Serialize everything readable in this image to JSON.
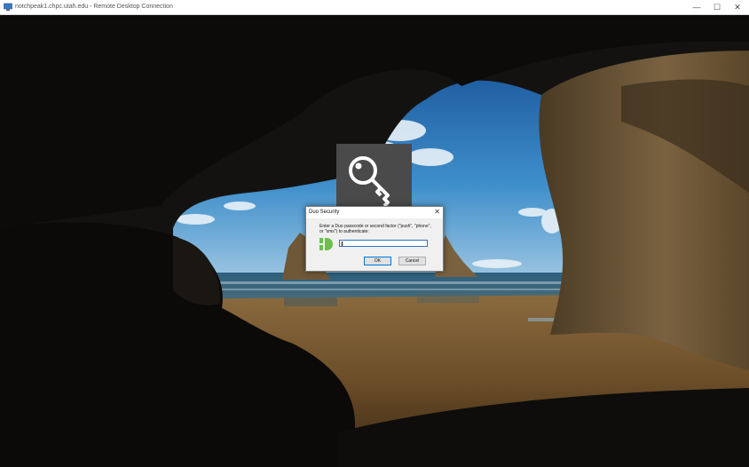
{
  "window": {
    "title": "notchpeak1.chpc.utah.edu - Remote Desktop Connection",
    "minimize": "—",
    "maximize": "☐",
    "close": "✕"
  },
  "dialog": {
    "title": "Duo Security",
    "close": "✕",
    "message": "Enter a Duo passcode or second factor (\"push\", \"phone\", or \"sms\") to authenticate:",
    "input_value": "",
    "ok_label": "OK",
    "cancel_label": "Cancel"
  },
  "colors": {
    "duo_green": "#6bc04b",
    "focus_blue": "#0078d7",
    "tile_gray": "#4a4a4a"
  },
  "icons": [
    "rdp-app-icon",
    "key-icon",
    "duo-logo-icon",
    "close-icon"
  ]
}
